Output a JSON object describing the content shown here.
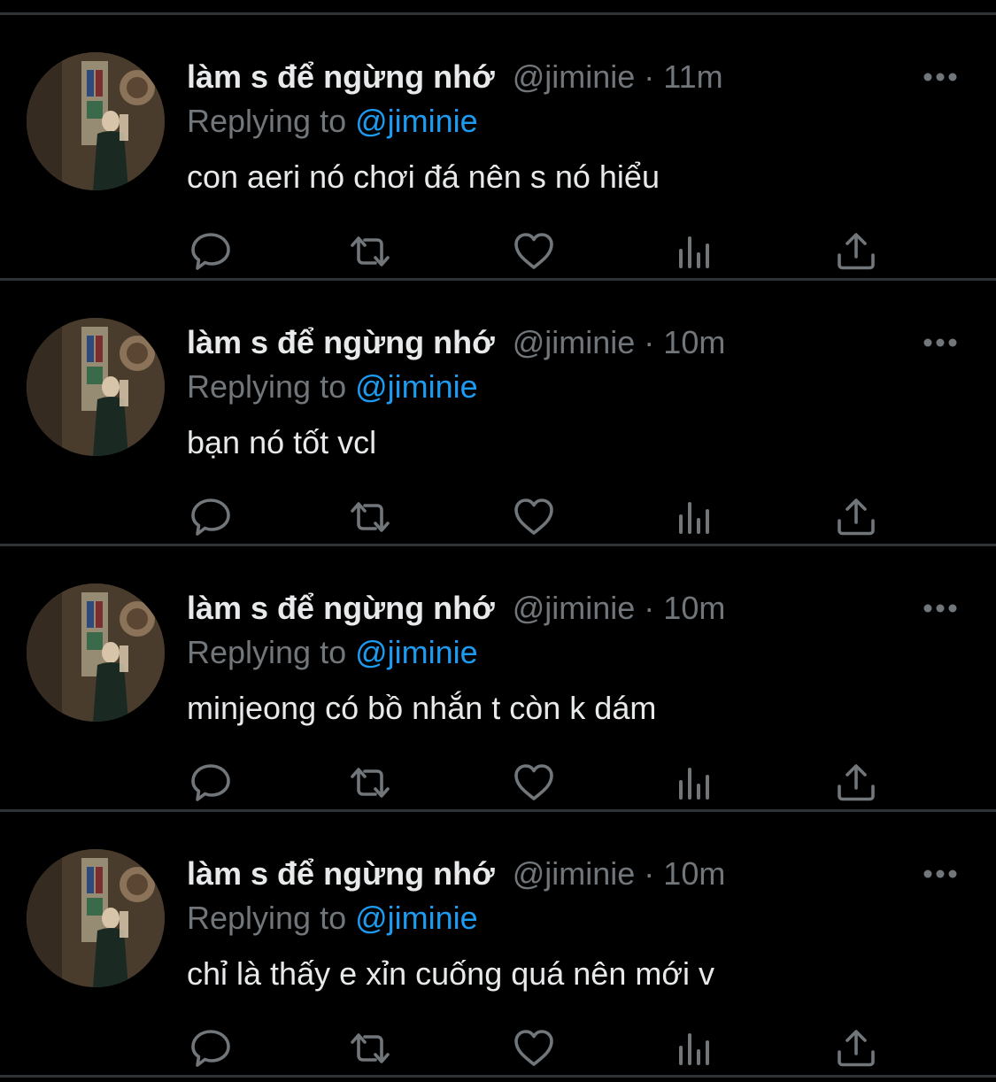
{
  "colors": {
    "background": "#000000",
    "divider": "#2f3336",
    "primary_text": "#e7e9ea",
    "secondary_text": "#71767b",
    "link": "#1d9bf0"
  },
  "icons": {
    "more": "more-horizontal-icon",
    "reply": "reply-bubble-icon",
    "retweet": "retweet-icon",
    "like": "heart-icon",
    "views": "bar-chart-icon",
    "share": "share-upload-icon"
  },
  "replies": [
    {
      "display_name": "làm s để ngừng nhớ",
      "handle": "@jiminie",
      "separator": "·",
      "time": "11m",
      "replying_prefix": "Replying to ",
      "replying_to": "@jiminie",
      "text": "con aeri nó chơi đá nên s nó hiểu"
    },
    {
      "display_name": "làm s để ngừng nhớ",
      "handle": "@jiminie",
      "separator": "·",
      "time": "10m",
      "replying_prefix": "Replying to ",
      "replying_to": "@jiminie",
      "text": "bạn nó tốt vcl"
    },
    {
      "display_name": "làm s để ngừng nhớ",
      "handle": "@jiminie",
      "separator": "·",
      "time": "10m",
      "replying_prefix": "Replying to ",
      "replying_to": "@jiminie",
      "text": "minjeong có bồ nhắn t còn k dám"
    },
    {
      "display_name": "làm s để ngừng nhớ",
      "handle": "@jiminie",
      "separator": "·",
      "time": "10m",
      "replying_prefix": "Replying to ",
      "replying_to": "@jiminie",
      "text": "chỉ là thấy e xỉn cuống quá nên mới v"
    }
  ]
}
